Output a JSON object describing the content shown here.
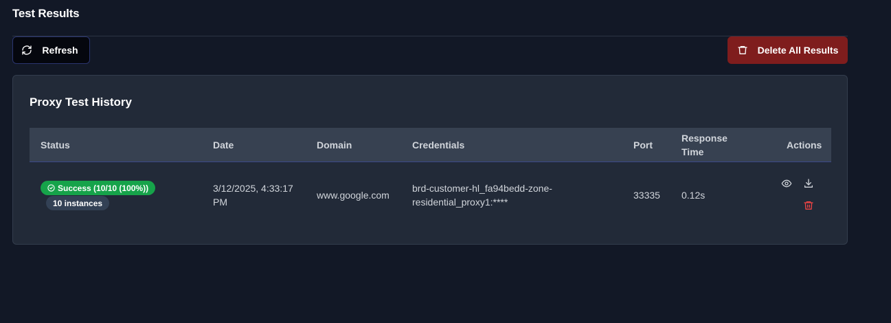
{
  "page": {
    "title": "Test Results"
  },
  "toolbar": {
    "refresh_label": "Refresh",
    "delete_all_label": "Delete All Results"
  },
  "history": {
    "title": "Proxy Test History",
    "columns": {
      "status": "Status",
      "date": "Date",
      "domain": "Domain",
      "credentials": "Credentials",
      "port": "Port",
      "response_time": "Response Time",
      "actions": "Actions"
    },
    "rows": [
      {
        "status_badge": "Success (10/10 (100%))",
        "instances_badge": "10 instances",
        "date": "3/12/2025, 4:33:17 PM",
        "domain": "www.google.com",
        "credentials": "brd-customer-hl_fa94bedd-zone-residential_proxy1:****",
        "port": "33335",
        "response_time": "0.12s",
        "actions": [
          "eye-icon",
          "download-icon",
          "trash-icon"
        ]
      }
    ]
  },
  "colors": {
    "background": "#121826",
    "card": "#222a38",
    "table_header": "#374151",
    "success": "#16a34a",
    "danger_button": "#7f1d1d",
    "danger_icon": "#ef4444"
  }
}
